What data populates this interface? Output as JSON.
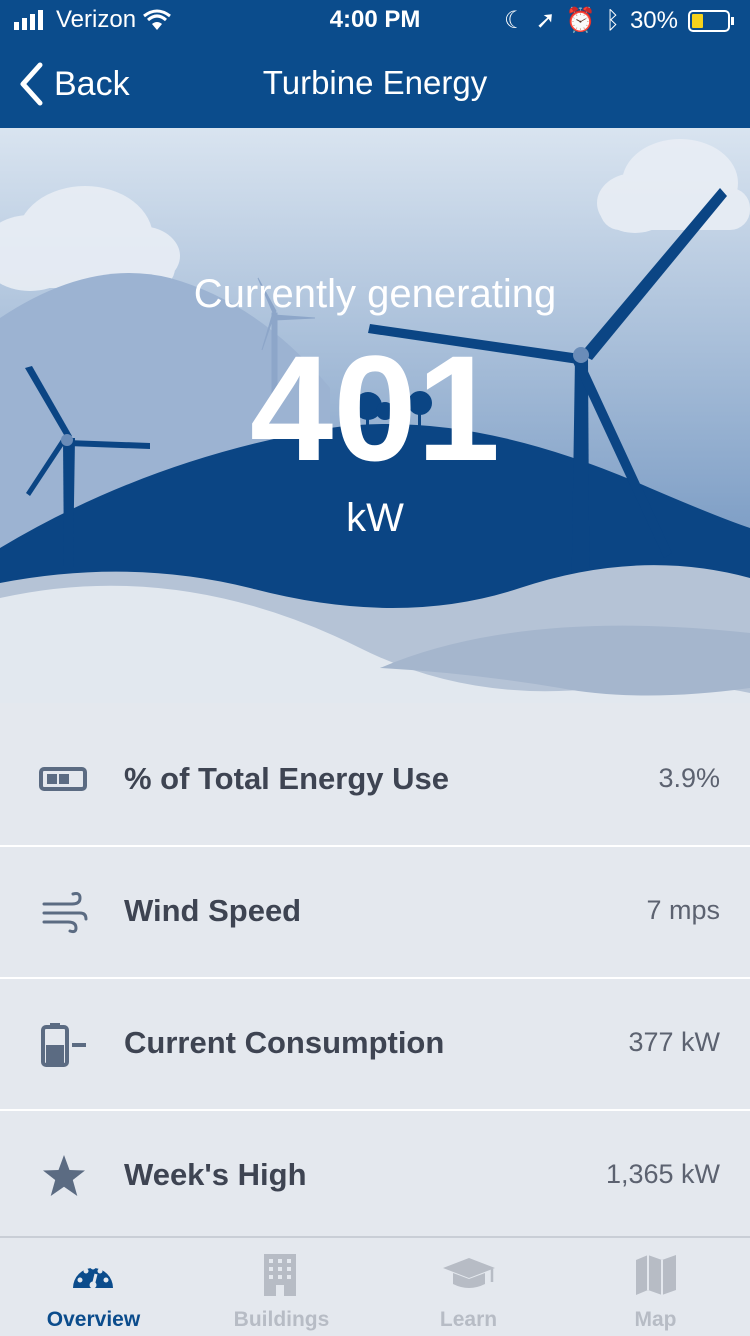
{
  "status_bar": {
    "carrier": "Verizon",
    "time": "4:00 PM",
    "battery": "30%"
  },
  "nav": {
    "back_label": "Back",
    "title": "Turbine Energy"
  },
  "hero": {
    "label": "Currently generating",
    "value": "401",
    "unit": "kW"
  },
  "stats": [
    {
      "icon": "battery-level-icon",
      "label": "% of Total Energy Use",
      "value": "3.9%"
    },
    {
      "icon": "wind-icon",
      "label": "Wind Speed",
      "value": "7 mps"
    },
    {
      "icon": "battery-minus-icon",
      "label": "Current Consumption",
      "value": "377 kW"
    },
    {
      "icon": "star-icon",
      "label": "Week's High",
      "value": "1,365 kW"
    }
  ],
  "tabs": [
    {
      "icon": "gauge-icon",
      "label": "Overview",
      "active": true
    },
    {
      "icon": "building-icon",
      "label": "Buildings",
      "active": false
    },
    {
      "icon": "graduation-cap-icon",
      "label": "Learn",
      "active": false
    },
    {
      "icon": "map-icon",
      "label": "Map",
      "active": false
    }
  ],
  "colors": {
    "primary": "#0b4c8c",
    "active_tab": "#0b4c8c",
    "inactive_tab": "#b7bcc5",
    "text_dark": "#3e4452",
    "row_bg": "#e4e8ee"
  }
}
